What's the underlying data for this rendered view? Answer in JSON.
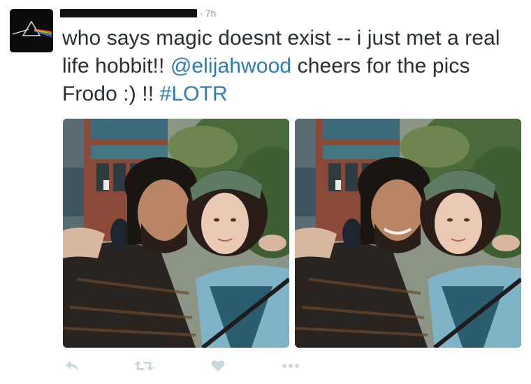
{
  "tweet": {
    "time": "7h",
    "separator": "·",
    "text_parts": {
      "p1": "who says magic doesnt exist -- i just met a real life hobbit!! ",
      "mention": "@elijahwood",
      "p2": " cheers for the pics Frodo :) !!  ",
      "hashtag": "#LOTR"
    }
  },
  "colors": {
    "link": "#2b7bb9",
    "text": "#292f33",
    "meta": "#8899a6",
    "action_icon": "#ccd6dd"
  },
  "icons": {
    "avatar": "prism-icon",
    "reply": "reply-icon",
    "retweet": "retweet-icon",
    "like": "heart-icon",
    "more": "more-icon"
  }
}
